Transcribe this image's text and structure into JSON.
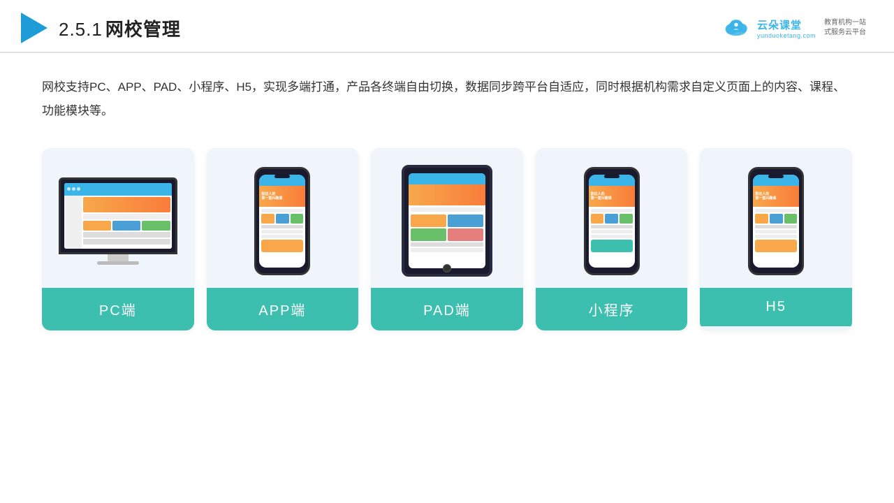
{
  "header": {
    "title_num": "2.5.1",
    "title_text": "网校管理",
    "logo": {
      "name": "云朵课堂",
      "url": "yunduoketang.com",
      "slogan_line1": "教育机构一站",
      "slogan_line2": "式服务云平台"
    }
  },
  "description": {
    "text": "网校支持PC、APP、PAD、小程序、H5，实现多端打通，产品各终端自由切换，数据同步跨平台自适应，同时根据机构需求自定义页面上的内容、课程、功能模块等。"
  },
  "cards": [
    {
      "id": "pc",
      "label": "PC端"
    },
    {
      "id": "app",
      "label": "APP端"
    },
    {
      "id": "pad",
      "label": "PAD端"
    },
    {
      "id": "miniprogram",
      "label": "小程序"
    },
    {
      "id": "h5",
      "label": "H5"
    }
  ],
  "colors": {
    "teal": "#3dbfb0",
    "blue_accent": "#3bb5e8",
    "orange": "#f8a84b",
    "dark": "#1a1a2e"
  }
}
